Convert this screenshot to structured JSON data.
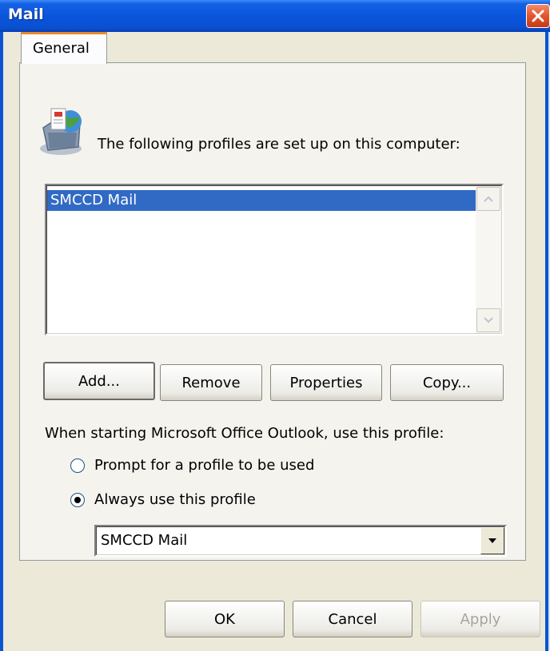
{
  "window": {
    "title": "Mail"
  },
  "tabs": [
    {
      "label": "General"
    }
  ],
  "profiles_header": "The following profiles are set up on this computer:",
  "profiles_list": [
    "SMCCD Mail"
  ],
  "buttons": {
    "add": "Add...",
    "remove": "Remove",
    "properties": "Properties",
    "copy": "Copy..."
  },
  "startup": {
    "label": "When starting Microsoft Office Outlook, use this profile:",
    "prompt_option": "Prompt for a profile to be used",
    "always_option": "Always use this profile",
    "selected_option": "always",
    "selected_profile": "SMCCD Mail"
  },
  "dialog_buttons": {
    "ok": "OK",
    "cancel": "Cancel",
    "apply": "Apply"
  },
  "colors": {
    "selection": "#316ac5",
    "titlebar": "#0a55dc",
    "face": "#ece9d8",
    "close": "#e2542e"
  },
  "icons": {
    "window_close": "close-icon",
    "profile": "mail-profile-icon"
  }
}
